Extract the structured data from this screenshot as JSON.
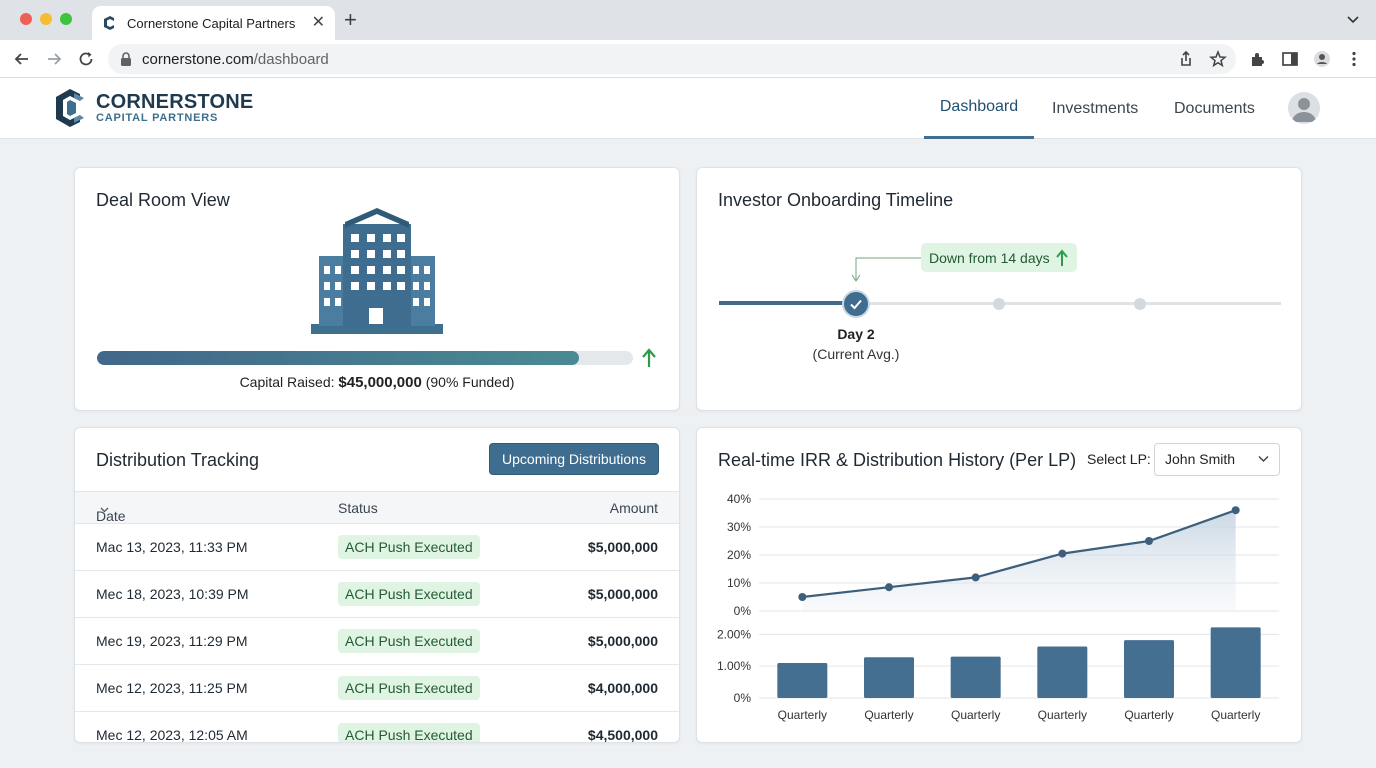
{
  "browser": {
    "tab_title": "Cornerstone Capital Partners",
    "url_host": "cornerstone.com",
    "url_path": "/dashboard"
  },
  "header": {
    "brand_name": "CORNERSTONE",
    "brand_sub": "CAPITAL PARTNERS",
    "nav": [
      "Dashboard",
      "Investments",
      "Documents"
    ],
    "active_nav": "Dashboard"
  },
  "deal_room": {
    "title": "Deal Room View",
    "capital_label": "Capital Raised:",
    "capital_value": "$45,000,000",
    "funded_text": "(90% Funded)",
    "funded_fraction": 0.9
  },
  "onboarding": {
    "title": "Investor Onboarding Timeline",
    "badge": "Down from 14 days",
    "current_day": "Day 2",
    "current_sub": "(Current Avg.)"
  },
  "distribution": {
    "title": "Distribution Tracking",
    "button": "Upcoming Distributions",
    "columns": [
      "Date",
      "Status",
      "Amount"
    ],
    "rows": [
      {
        "date": "Mac 13, 2023, 11:33 PM",
        "status": "ACH Push Executed",
        "amount": "$5,000,000"
      },
      {
        "date": "Mec 18, 2023, 10:39 PM",
        "status": "ACH Push Executed",
        "amount": "$5,000,000"
      },
      {
        "date": "Mec 19, 2023, 11:29 PM",
        "status": "ACH Push Executed",
        "amount": "$5,000,000"
      },
      {
        "date": "Mec 12, 2023, 11:25 PM",
        "status": "ACH Push Executed",
        "amount": "$4,000,000"
      },
      {
        "date": "Mec 12, 2023, 12:05 AM",
        "status": "ACH Push Executed",
        "amount": "$4,500,000"
      }
    ]
  },
  "irr": {
    "title": "Real-time IRR & Distribution History (Per LP)",
    "select_label": "Select LP:",
    "selected_lp": "John Smith"
  },
  "chart_data": [
    {
      "type": "line",
      "x": [
        "Quarterly",
        "Quarterly",
        "Quarterly",
        "Quarterly",
        "Quarterly",
        "Quarterly"
      ],
      "y_ticks": [
        "40%",
        "30%",
        "20%",
        "10%",
        "0%"
      ],
      "ylim": [
        0,
        40
      ],
      "series": [
        {
          "values": [
            5,
            8.5,
            12,
            20.5,
            25,
            36
          ]
        }
      ],
      "grid": true,
      "area_fill": true
    },
    {
      "type": "bar",
      "categories": [
        "Quarterly",
        "Quarterly",
        "Quarterly",
        "Quarterly",
        "Quarterly",
        "Quarterly"
      ],
      "y_ticks": [
        "2.00%",
        "1.00%",
        "0%"
      ],
      "ylim": [
        0,
        2.2
      ],
      "values": [
        1.1,
        1.28,
        1.3,
        1.62,
        1.82,
        2.22
      ],
      "grid": true
    }
  ],
  "colors": {
    "accent": "#3e6d8f",
    "bar": "#456f90",
    "success_bg": "#dff4e3",
    "success_text": "#245a33",
    "arrow_green": "#2e9b48"
  }
}
